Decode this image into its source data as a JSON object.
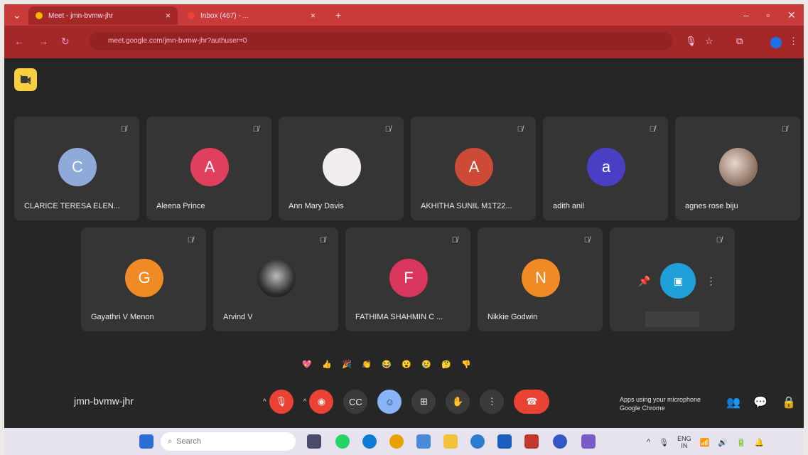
{
  "browser": {
    "tabs": [
      {
        "label": "Meet - jmn-bvmw-jhr",
        "active": true,
        "color": "#f5b400"
      },
      {
        "label": "Inbox (467) - ...",
        "active": false,
        "color": "#ea4335"
      }
    ],
    "url": "meet.google.com/jmn-bvmw-jhr?authuser=0"
  },
  "participants_row1": [
    {
      "name": "CLARICE TERESA ELEN...",
      "initial": "C",
      "color": "#8fa9d8",
      "kind": "letter"
    },
    {
      "name": "Aleena Prince",
      "initial": "A",
      "color": "#e0405e",
      "kind": "letter"
    },
    {
      "name": "Ann Mary Davis",
      "initial": "",
      "color": "#f2eeee",
      "kind": "letter"
    },
    {
      "name": "AKHITHA SUNIL M1T22...",
      "initial": "A",
      "color": "#cc4a36",
      "kind": "letter"
    },
    {
      "name": "adith anil",
      "initial": "a",
      "color": "#4a3fc4",
      "kind": "letter"
    },
    {
      "name": "agnes rose biju",
      "initial": "",
      "color": "#c9b5a8",
      "kind": "photo"
    }
  ],
  "participants_row2": [
    {
      "name": "Gayathri V Menon",
      "initial": "G",
      "color": "#f08a24",
      "kind": "letter"
    },
    {
      "name": "Arvind V",
      "initial": "",
      "color": "#444444",
      "kind": "photo2"
    },
    {
      "name": "FATHIMA SHAHMIN C ...",
      "initial": "F",
      "color": "#d8365c",
      "kind": "letter"
    },
    {
      "name": "Nikkie Godwin",
      "initial": "N",
      "color": "#f08a24",
      "kind": "letter"
    }
  ],
  "reactions": [
    "💖",
    "👍",
    "🎉",
    "👏",
    "😂",
    "😮",
    "😢",
    "🤔",
    "👎"
  ],
  "meeting_code": "jmn-bvmw-jhr",
  "mic_notice": {
    "line1": "Apps using your microphone",
    "line2": "Google Chrome"
  },
  "taskbar": {
    "search_placeholder": "Search",
    "lang1": "ENG",
    "lang2": "IN"
  }
}
